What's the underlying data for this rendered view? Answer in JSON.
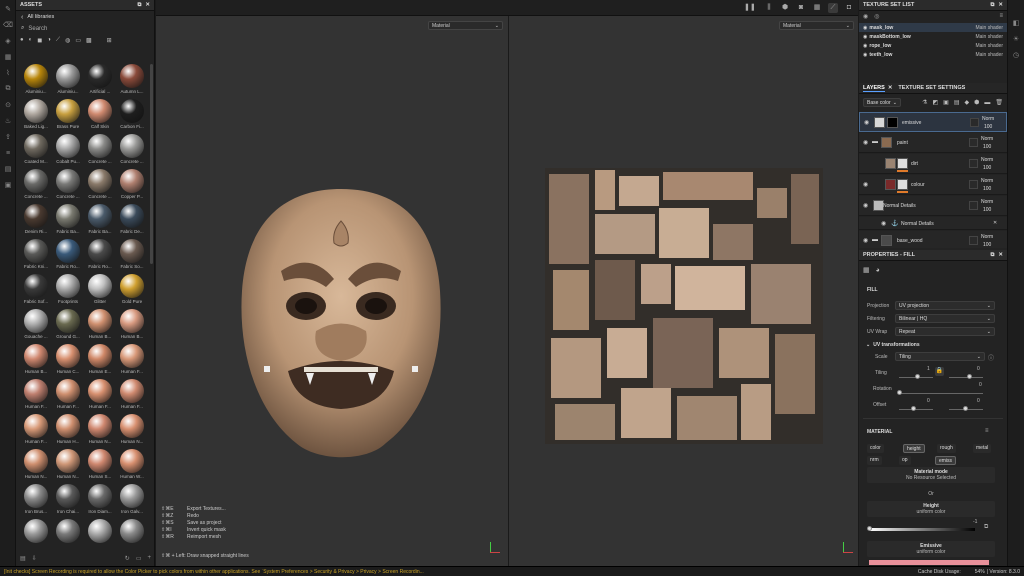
{
  "assets": {
    "title": "ASSETS",
    "breadcrumb": "All libraries",
    "search_placeholder": "Search",
    "items": [
      {
        "label": "Aluminiu...",
        "color": "#b8860b"
      },
      {
        "label": "Aluminiu...",
        "color": "#9a9a9a"
      },
      {
        "label": "Artificial ...",
        "color": "#2a2a2a"
      },
      {
        "label": "Autumn L...",
        "color": "#8a4a3a"
      },
      {
        "label": "Baked Lig...",
        "color": "#b0a8a0"
      },
      {
        "label": "Brass Pure",
        "color": "#c8a040"
      },
      {
        "label": "Calf Skin",
        "color": "#d08a70"
      },
      {
        "label": "Carbon Fi...",
        "color": "#1e1e1e"
      },
      {
        "label": "Coated M...",
        "color": "#706a60"
      },
      {
        "label": "Cobalt Pu...",
        "color": "#a8a8a8"
      },
      {
        "label": "Concrete ...",
        "color": "#8a8a88"
      },
      {
        "label": "Concrete ...",
        "color": "#9a9a98"
      },
      {
        "label": "Concrete ...",
        "color": "#6a6a68"
      },
      {
        "label": "Concrete ...",
        "color": "#7a7a78"
      },
      {
        "label": "Concrete ...",
        "color": "#8a7a6a"
      },
      {
        "label": "Copper P...",
        "color": "#b08070"
      },
      {
        "label": "Denim Ri...",
        "color": "#4a3a30"
      },
      {
        "label": "Fabric Ba...",
        "color": "#7a7a70"
      },
      {
        "label": "Fabric Ba...",
        "color": "#4a5a6a"
      },
      {
        "label": "Fabric De...",
        "color": "#3a4a5a"
      },
      {
        "label": "Fabric Kni...",
        "color": "#5a5a58"
      },
      {
        "label": "Fabric Ro...",
        "color": "#3a5a7a"
      },
      {
        "label": "Fabric Ro...",
        "color": "#4a4a4a"
      },
      {
        "label": "Fabric So...",
        "color": "#6a5a50"
      },
      {
        "label": "Fabric Sof...",
        "color": "#3a3a3a"
      },
      {
        "label": "Footprints",
        "color": "#aaaaaa"
      },
      {
        "label": "Glitter",
        "color": "#c0c0c0"
      },
      {
        "label": "Gold Pure",
        "color": "#d0a030"
      },
      {
        "label": "Gouache ...",
        "color": "#b0b0b0"
      },
      {
        "label": "Ground G...",
        "color": "#6a6a50"
      },
      {
        "label": "Human B...",
        "color": "#d09070"
      },
      {
        "label": "Human B...",
        "color": "#d89a80"
      },
      {
        "label": "Human B...",
        "color": "#d08870"
      },
      {
        "label": "Human C...",
        "color": "#d89070"
      },
      {
        "label": "Human E...",
        "color": "#d08868"
      },
      {
        "label": "Human F...",
        "color": "#d89878"
      },
      {
        "label": "Human F...",
        "color": "#c08070"
      },
      {
        "label": "Human F...",
        "color": "#d09070"
      },
      {
        "label": "Human F...",
        "color": "#d89070"
      },
      {
        "label": "Human F...",
        "color": "#d08a70"
      },
      {
        "label": "Human F...",
        "color": "#d89a78"
      },
      {
        "label": "Human H...",
        "color": "#d09070"
      },
      {
        "label": "Human N...",
        "color": "#d08870"
      },
      {
        "label": "Human N...",
        "color": "#d89070"
      },
      {
        "label": "Human N...",
        "color": "#d09070"
      },
      {
        "label": "Human N...",
        "color": "#d09878"
      },
      {
        "label": "Human S...",
        "color": "#d08870"
      },
      {
        "label": "Human W...",
        "color": "#d89070"
      },
      {
        "label": "Iron Brus...",
        "color": "#8a8a8a"
      },
      {
        "label": "Iron Chai...",
        "color": "#5a5a5a"
      },
      {
        "label": "Iron Diam...",
        "color": "#6a6a6a"
      },
      {
        "label": "Iron Galv...",
        "color": "#9a9a9a"
      },
      {
        "label": "",
        "color": "#9a9a9a"
      },
      {
        "label": "",
        "color": "#7a7a7a"
      },
      {
        "label": "",
        "color": "#aaaaaa"
      },
      {
        "label": "",
        "color": "#8a8a8a"
      }
    ]
  },
  "viewport": {
    "mode_3d": "Material",
    "mode_2d": "Material",
    "shortcuts": [
      {
        "key": "⇧⌘E",
        "label": "Export Textures..."
      },
      {
        "key": "⇧⌘Z",
        "label": "Redo"
      },
      {
        "key": "⇧⌘S",
        "label": "Save as project"
      },
      {
        "key": "⇧⌘I",
        "label": "Invert quick mask"
      },
      {
        "key": "⇧⌘R",
        "label": "Reimport mesh"
      }
    ],
    "shortcut_hint": "⇧⌘ + Left: Draw snapped straight lines"
  },
  "texture_set_list": {
    "title": "TEXTURE SET LIST",
    "items": [
      {
        "name": "mask_low",
        "shader": "Main shader"
      },
      {
        "name": "maskBottom_low",
        "shader": "Main shader"
      },
      {
        "name": "rope_low",
        "shader": "Main shader"
      },
      {
        "name": "teeth_low",
        "shader": "Main shader"
      }
    ]
  },
  "layers": {
    "tab_layers": "LAYERS",
    "tab_settings": "TEXTURE SET SETTINGS",
    "channel": "Base color",
    "items": [
      {
        "name": "emissive",
        "blend": "Norm",
        "opacity": "100"
      },
      {
        "name": "paint",
        "blend": "Norm",
        "opacity": "100"
      },
      {
        "name": "dirt",
        "blend": "Norm",
        "opacity": "100"
      },
      {
        "name": "colour",
        "blend": "Norm",
        "opacity": "100"
      },
      {
        "name": "Normal Details",
        "blend": "Norm",
        "opacity": "100"
      },
      {
        "name": "Normal Details",
        "blend": "",
        "opacity": ""
      },
      {
        "name": "base_wood",
        "blend": "Norm",
        "opacity": "100"
      }
    ]
  },
  "properties": {
    "title": "PROPERTIES - FILL",
    "fill_section": "FILL",
    "projection_label": "Projection",
    "projection_value": "UV projection",
    "filtering_label": "Filtering",
    "filtering_value": "Bilinear | HQ",
    "uvwrap_label": "UV Wrap",
    "uvwrap_value": "Repeat",
    "uvtrans_label": "UV transformations",
    "scale_label": "Scale",
    "scale_value": "Tiling",
    "tiling_label": "Tiling",
    "tiling_value": "1",
    "rotation_label": "Rotation",
    "rotation_value": "0",
    "offset_label": "Offset",
    "offset_x": "0",
    "offset_y": "0",
    "tiling_y": "0",
    "material_section": "MATERIAL",
    "channels": [
      {
        "label": "color",
        "on": false
      },
      {
        "label": "height",
        "on": true
      },
      {
        "label": "rough",
        "on": false
      },
      {
        "label": "metal",
        "on": false
      },
      {
        "label": "nrm",
        "on": false
      },
      {
        "label": "op",
        "on": false
      },
      {
        "label": "emiss",
        "on": true
      }
    ],
    "material_mode_label": "Material mode",
    "material_mode_value": "No Resource Selected",
    "or_label": "Or",
    "height_label": "Height",
    "height_sub": "uniform color",
    "height_value": "-1",
    "emissive_label": "Emissive",
    "emissive_sub": "uniform color",
    "emissive_color": "#e8909a"
  },
  "status": {
    "message": "[Init checks] Screen Recording is required to allow the Color Picker to pick colors from within other applications. See `System Preferences > Security & Privacy > Privacy > Screen Recordin...",
    "cache": "Cache Disk Usage:",
    "usage": "54%",
    "version": "| Version: 8.3.0"
  }
}
